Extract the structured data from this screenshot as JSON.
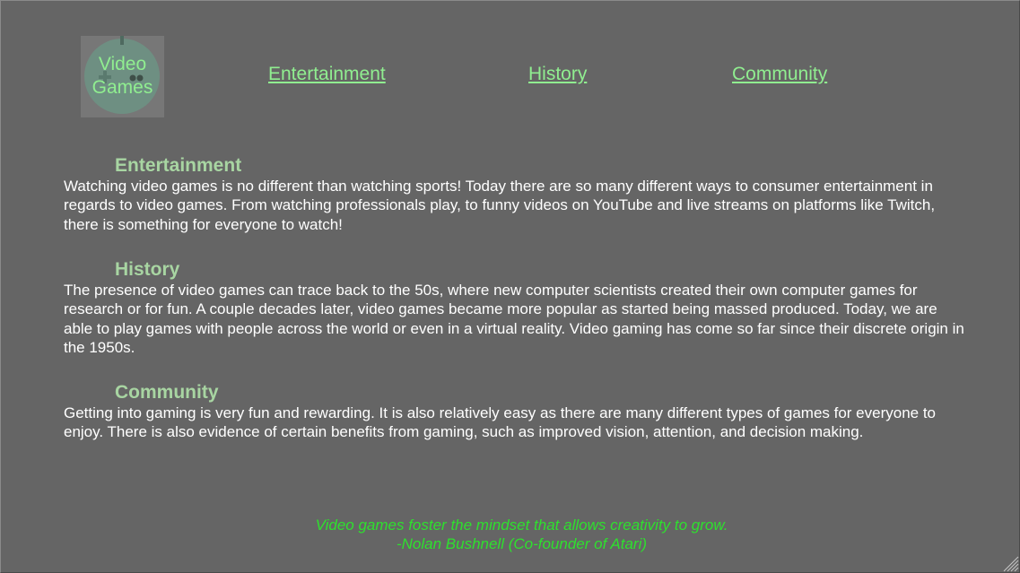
{
  "logo": {
    "text": "Video Games"
  },
  "nav": {
    "entertainment": "Entertainment",
    "history": "History",
    "community": "Community"
  },
  "sections": [
    {
      "heading": "Entertainment",
      "body": "Watching video games is no different than watching sports! Today there are so many different ways to consumer entertainment in regards to video games. From watching professionals play, to funny videos on YouTube and live streams on platforms like Twitch, there is something for everyone to watch!"
    },
    {
      "heading": "History",
      "body": "The presence of video games can trace back to the 50s, where new computer scientists created their own computer games for research or for fun. A couple decades later, video games became more popular as started being massed produced. Today, we are able to play games with people across the world or even in a virtual reality. Video gaming has come so far since their discrete origin in the 1950s."
    },
    {
      "heading": "Community",
      "body": "Getting into gaming is very fun and rewarding. It is also relatively easy as there are many different types of games for everyone to enjoy. There is also evidence of certain benefits from gaming, such as improved vision, attention, and decision making."
    }
  ],
  "quote": {
    "text": "Video games foster the mindset that allows creativity to grow.",
    "attribution": "-Nolan Bushnell (Co-founder of Atari)"
  },
  "colors": {
    "background": "#656565",
    "link": "#90ee90",
    "heading": "#a8d5a2",
    "quote": "#2ee02e"
  }
}
